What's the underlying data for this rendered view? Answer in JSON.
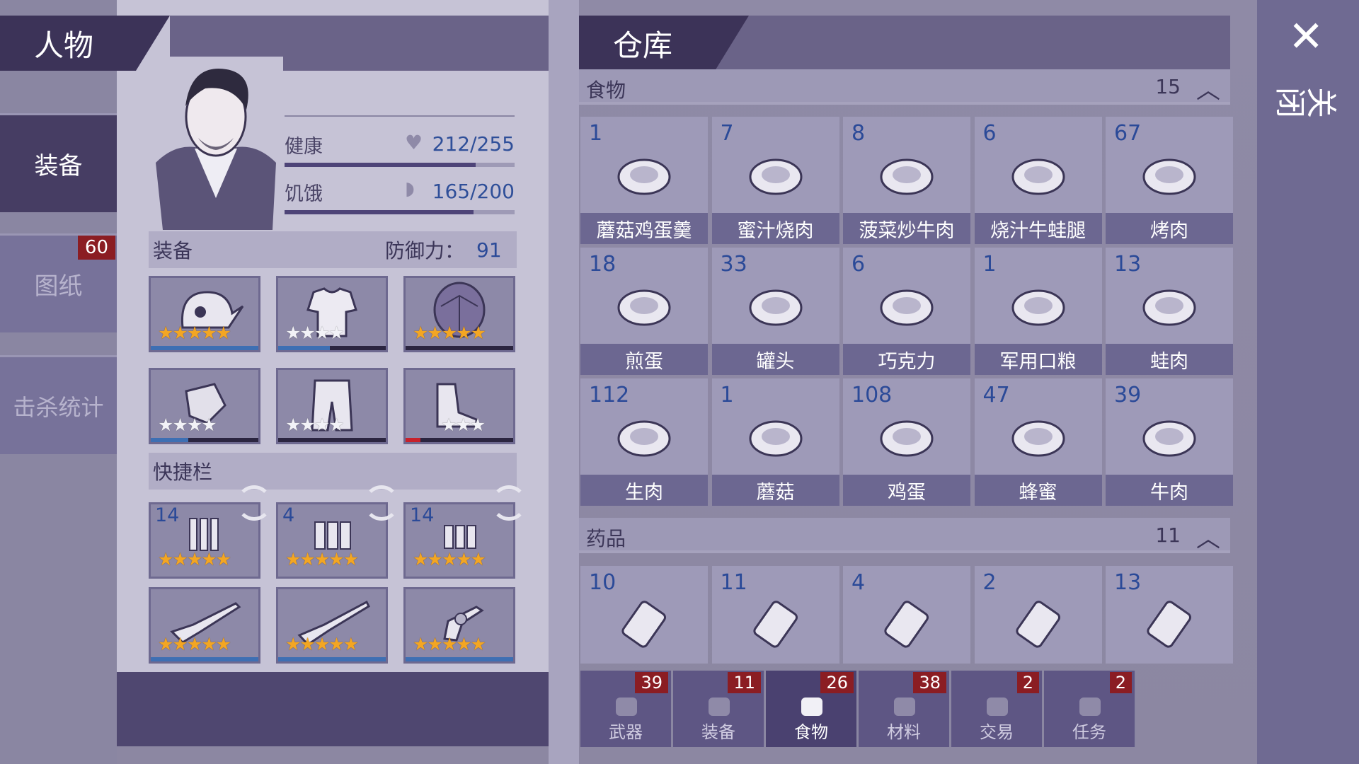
{
  "header": {
    "character_title": "人物",
    "warehouse_title": "仓库",
    "close_label": "关闭"
  },
  "side_tabs": [
    {
      "label": "装备",
      "badge": ""
    },
    {
      "label": "图纸",
      "badge": "60"
    },
    {
      "label": "击杀统计",
      "badge": ""
    }
  ],
  "stats": {
    "health_label": "健康",
    "health_value": "212/255",
    "health_fraction": 0.83,
    "hunger_label": "饥饿",
    "hunger_value": "165/200",
    "hunger_fraction": 0.82
  },
  "equipment": {
    "title": "装备",
    "defense_label": "防御力：",
    "defense_value": "91",
    "slots": [
      {
        "icon": "helmet-icon",
        "stars": 5
      },
      {
        "icon": "shirt-icon",
        "stars": 4
      },
      {
        "icon": "shell-armor-icon",
        "stars": 5
      },
      {
        "icon": "gloves-icon",
        "stars": 4
      },
      {
        "icon": "pants-icon",
        "stars": 4
      },
      {
        "icon": "boots-icon",
        "stars": 3
      }
    ]
  },
  "quickbar": {
    "title": "快捷栏",
    "ammo": [
      {
        "count": "14",
        "icon": "bullets-icon",
        "stars": 5
      },
      {
        "count": "4",
        "icon": "shells-icon",
        "stars": 5
      },
      {
        "count": "14",
        "icon": "cartridges-icon",
        "stars": 5
      }
    ],
    "weapons": [
      {
        "icon": "rifle-icon",
        "stars": 5
      },
      {
        "icon": "shotgun-icon",
        "stars": 5
      },
      {
        "icon": "revolver-icon",
        "stars": 5
      }
    ]
  },
  "food": {
    "title": "食物",
    "count": "15",
    "items": [
      {
        "count": "1",
        "name": "蘑菇鸡蛋羹",
        "icon": "pot-icon"
      },
      {
        "count": "7",
        "name": "蜜汁烧肉",
        "icon": "roast-icon"
      },
      {
        "count": "8",
        "name": "菠菜炒牛肉",
        "icon": "pan-icon"
      },
      {
        "count": "6",
        "name": "烧汁牛蛙腿",
        "icon": "frog-legs-icon"
      },
      {
        "count": "67",
        "name": "烤肉",
        "icon": "grilled-meat-icon"
      },
      {
        "count": "18",
        "name": "煎蛋",
        "icon": "fried-egg-icon"
      },
      {
        "count": "33",
        "name": "罐头",
        "icon": "can-icon"
      },
      {
        "count": "6",
        "name": "巧克力",
        "icon": "chocolate-icon"
      },
      {
        "count": "1",
        "name": "军用口粮",
        "icon": "ration-icon"
      },
      {
        "count": "13",
        "name": "蛙肉",
        "icon": "frog-meat-icon"
      },
      {
        "count": "112",
        "name": "生肉",
        "icon": "raw-meat-icon"
      },
      {
        "count": "1",
        "name": "蘑菇",
        "icon": "mushroom-icon"
      },
      {
        "count": "108",
        "name": "鸡蛋",
        "icon": "eggs-icon"
      },
      {
        "count": "47",
        "name": "蜂蜜",
        "icon": "honeycomb-icon"
      },
      {
        "count": "39",
        "name": "牛肉",
        "icon": "beef-icon"
      }
    ]
  },
  "medicine": {
    "title": "药品",
    "count": "11",
    "items": [
      {
        "count": "10",
        "icon": "pill-bottle-icon"
      },
      {
        "count": "11",
        "icon": "syringe-icon"
      },
      {
        "count": "4",
        "icon": "medkit-icon"
      },
      {
        "count": "2",
        "icon": "vial-icon"
      },
      {
        "count": "13",
        "icon": "spray-bottle-icon"
      }
    ]
  },
  "bottom_tabs": [
    {
      "label": "武器",
      "count": "39",
      "icon": "axe-icon"
    },
    {
      "label": "装备",
      "count": "11",
      "icon": "shirt-icon"
    },
    {
      "label": "食物",
      "count": "26",
      "icon": "meat-icon",
      "active": true
    },
    {
      "label": "材料",
      "count": "38",
      "icon": "wood-icon"
    },
    {
      "label": "交易",
      "count": "2",
      "icon": "coin-icon"
    },
    {
      "label": "任务",
      "count": "2",
      "icon": "key-icon"
    }
  ]
}
